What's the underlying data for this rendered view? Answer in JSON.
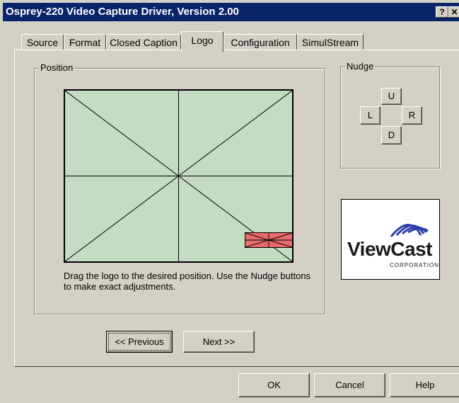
{
  "window": {
    "title": "Osprey-220 Video Capture Driver, Version 2.00",
    "help_button": "?",
    "close_button": "✕"
  },
  "tabs": [
    {
      "label": "Source"
    },
    {
      "label": "Format"
    },
    {
      "label": "Closed Caption"
    },
    {
      "label": "Logo",
      "active": true
    },
    {
      "label": "Configuration"
    },
    {
      "label": "SimulStream"
    }
  ],
  "position": {
    "group_label": "Position",
    "hint": "Drag the logo to the desired position.  Use the Nudge buttons to make exact adjustments."
  },
  "nudge": {
    "group_label": "Nudge",
    "up": "U",
    "left": "L",
    "right": "R",
    "down": "D"
  },
  "logo": {
    "brand": "ViewCast",
    "sub": "CORPORATION",
    "brand_color": "#1a1a1a",
    "swoosh_color": "#2f3fa8"
  },
  "wizard": {
    "previous": "<< Previous",
    "next": "Next >>"
  },
  "footer": {
    "ok": "OK",
    "cancel": "Cancel",
    "help": "Help"
  },
  "colors": {
    "titlebar": "#0a246a",
    "preview_bg": "#c4dcc4",
    "logo_marker": "#e86a6a"
  }
}
